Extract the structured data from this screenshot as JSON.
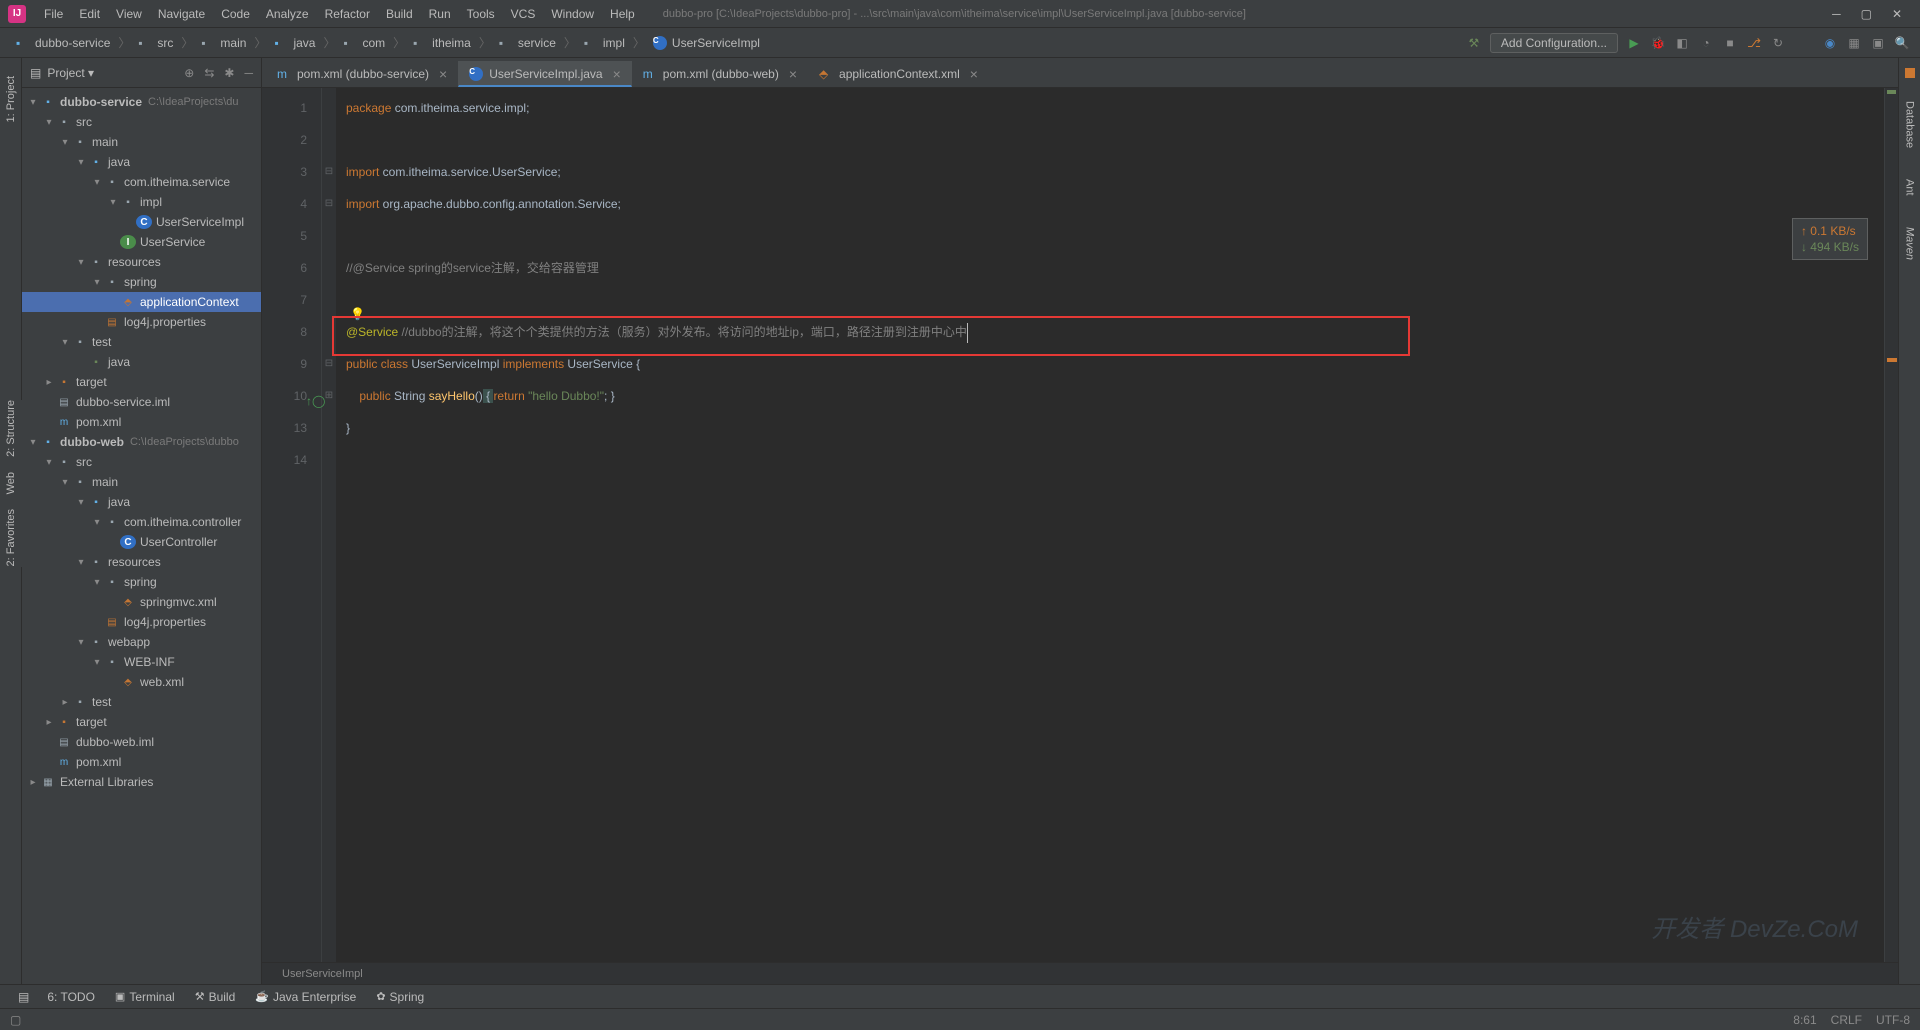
{
  "logo": "IJ",
  "menu": [
    "File",
    "Edit",
    "View",
    "Navigate",
    "Code",
    "Analyze",
    "Refactor",
    "Build",
    "Run",
    "Tools",
    "VCS",
    "Window",
    "Help"
  ],
  "windowTitle": "dubbo-pro [C:\\IdeaProjects\\dubbo-pro] - ...\\src\\main\\java\\com\\itheima\\service\\impl\\UserServiceImpl.java [dubbo-service]",
  "breadcrumbs": [
    "dubbo-service",
    "src",
    "main",
    "java",
    "com",
    "itheima",
    "service",
    "impl",
    "UserServiceImpl"
  ],
  "addConfig": "Add Configuration...",
  "projectLabel": "Project",
  "tree": {
    "n0": {
      "label": "dubbo-service",
      "dim": "C:\\IdeaProjects\\du"
    },
    "n1": {
      "label": "src"
    },
    "n2": {
      "label": "main"
    },
    "n3": {
      "label": "java"
    },
    "n4": {
      "label": "com.itheima.service"
    },
    "n5": {
      "label": "impl"
    },
    "n6": {
      "label": "UserServiceImpl"
    },
    "n7": {
      "label": "UserService"
    },
    "n8": {
      "label": "resources"
    },
    "n9": {
      "label": "spring"
    },
    "n10": {
      "label": "applicationContext"
    },
    "n11": {
      "label": "log4j.properties"
    },
    "n12": {
      "label": "test"
    },
    "n13": {
      "label": "java"
    },
    "n14": {
      "label": "target"
    },
    "n15": {
      "label": "dubbo-service.iml"
    },
    "n16": {
      "label": "pom.xml"
    },
    "n17": {
      "label": "dubbo-web",
      "dim": "C:\\IdeaProjects\\dubbo"
    },
    "n18": {
      "label": "src"
    },
    "n19": {
      "label": "main"
    },
    "n20": {
      "label": "java"
    },
    "n21": {
      "label": "com.itheima.controller"
    },
    "n22": {
      "label": "UserController"
    },
    "n23": {
      "label": "resources"
    },
    "n24": {
      "label": "spring"
    },
    "n25": {
      "label": "springmvc.xml"
    },
    "n26": {
      "label": "log4j.properties"
    },
    "n27": {
      "label": "webapp"
    },
    "n28": {
      "label": "WEB-INF"
    },
    "n29": {
      "label": "web.xml"
    },
    "n30": {
      "label": "test"
    },
    "n31": {
      "label": "target"
    },
    "n32": {
      "label": "dubbo-web.iml"
    },
    "n33": {
      "label": "pom.xml"
    },
    "n34": {
      "label": "External Libraries"
    }
  },
  "tabs": [
    {
      "label": "pom.xml (dubbo-service)",
      "icon": "m"
    },
    {
      "label": "UserServiceImpl.java",
      "icon": "c",
      "active": true
    },
    {
      "label": "pom.xml (dubbo-web)",
      "icon": "m"
    },
    {
      "label": "applicationContext.xml",
      "icon": "x"
    }
  ],
  "code": {
    "l1_kw": "package",
    "l1_rest": " com.itheima.service.impl;",
    "l3_kw": "import",
    "l3_rest": " com.itheima.service.UserService;",
    "l4_kw": "import",
    "l4_rest": " org.apache.dubbo.config.annotation.",
    "l4_cls": "Service",
    "l4_end": ";",
    "l6": "//@Service spring的service注解，交给容器管理",
    "l8_ann": "@Service",
    "l8_cmt": " //dubbo的注解，将这个个类提供的方法（服务）对外发布。将访问的地址ip，端口，路径注册到注册中心中",
    "l9_a": "public class ",
    "l9_b": "UserServiceImpl ",
    "l9_c": "implements ",
    "l9_d": "UserService ",
    "l9_e": "{",
    "l10_a": "    public ",
    "l10_b": "String ",
    "l10_c": "sayHello",
    "l10_d": "()",
    "l10_e": " { ",
    "l10_f": "return ",
    "l10_g": "\"hello Dubbo!\"",
    "l10_h": "; }",
    "l13": "}"
  },
  "breadcrumbBar": "UserServiceImpl",
  "bottomTools": [
    "6: TODO",
    "Terminal",
    "Build",
    "Java Enterprise",
    "Spring"
  ],
  "status": {
    "pos": "8:61",
    "lf": "CRLF",
    "enc": "UTF-8"
  },
  "net": {
    "up": "↑ 0.1 KB/s",
    "dn": "↓ 494 KB/s"
  },
  "leftTabs": [
    "1: Project"
  ],
  "leftTabs2": [
    "2: Structure",
    "Web",
    "2: Favorites"
  ],
  "rightTabs": [
    "Database",
    "Ant",
    "Maven"
  ],
  "watermark": "开发者 DevZe.CoM"
}
